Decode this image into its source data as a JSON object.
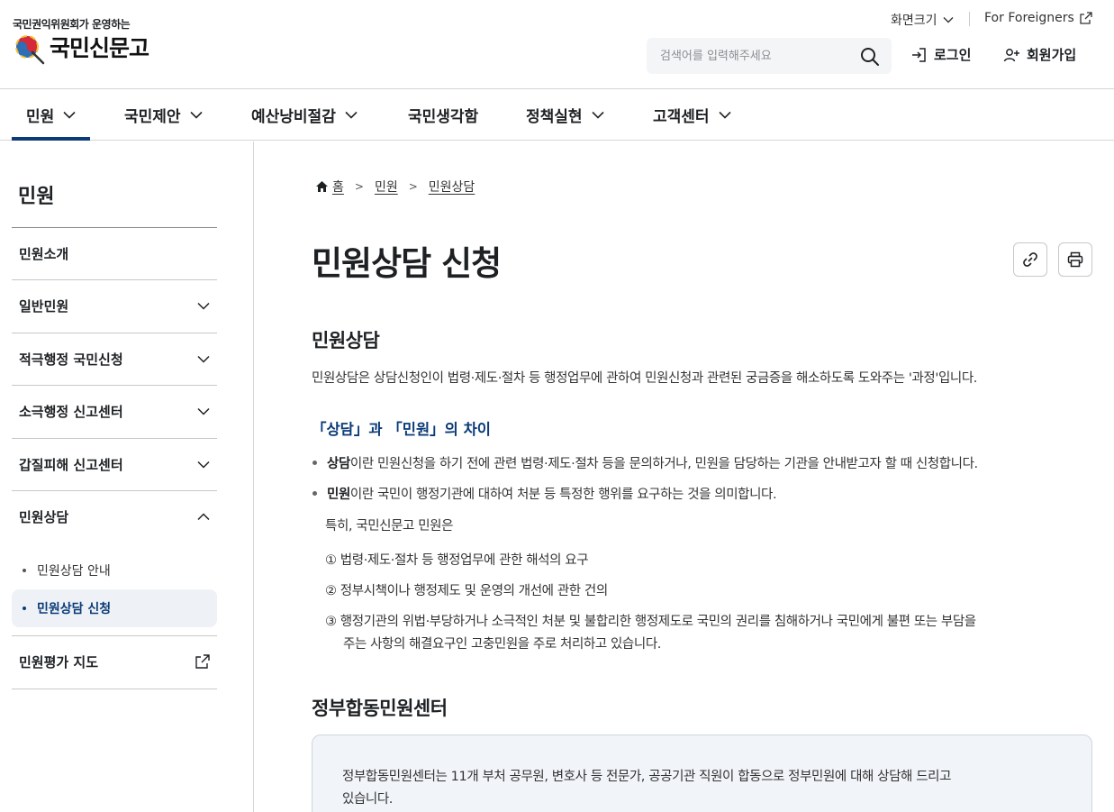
{
  "header": {
    "logo_sub": "국민권익위원회가 운영하는",
    "logo_text": "국민신문고",
    "util_size": "화면크기",
    "util_foreign": "For Foreigners",
    "search_placeholder": "검색어를 입력해주세요",
    "login": "로그인",
    "join": "회원가입"
  },
  "gnb": {
    "items": [
      {
        "label": "민원",
        "has_menu": true,
        "active": true
      },
      {
        "label": "국민제안",
        "has_menu": true
      },
      {
        "label": "예산낭비절감",
        "has_menu": true
      },
      {
        "label": "국민생각함",
        "has_menu": false
      },
      {
        "label": "정책실현",
        "has_menu": true
      },
      {
        "label": "고객센터",
        "has_menu": true
      }
    ]
  },
  "lnb": {
    "title": "민원",
    "items": [
      {
        "label": "민원소개",
        "icon": "none"
      },
      {
        "label": "일반민원",
        "icon": "chevron-down"
      },
      {
        "label": "적극행정 국민신청",
        "icon": "chevron-down"
      },
      {
        "label": "소극행정 신고센터",
        "icon": "chevron-down"
      },
      {
        "label": "갑질피해 신고센터",
        "icon": "chevron-down"
      },
      {
        "label": "민원상담",
        "icon": "chevron-up"
      },
      {
        "label": "민원평가 지도",
        "icon": "external-link"
      }
    ],
    "sub_items": [
      {
        "label": "민원상담 안내",
        "active": false
      },
      {
        "label": "민원상담 신청",
        "active": true
      }
    ]
  },
  "breadcrumb": {
    "home": "홈",
    "level1": "민원",
    "level2": "민원상담"
  },
  "content": {
    "title": "민원상담 신청",
    "section1_title": "민원상담",
    "section1_desc": "민원상담은 상담신청인이 법령·제도·절차 등 행정업무에 관하여 민원신청과 관련된 궁금증을 해소하도록 도와주는 '과정'입니다.",
    "diff_title": "「상담」과 「민원」의 차이",
    "bullet1_bold": "상담",
    "bullet1_rest": "이란 민원신청을 하기 전에 관련 법령·제도·절차 등을 문의하거나, 민원을 담당하는 기관을 안내받고자 할 때 신청합니다.",
    "bullet2_bold": "민원",
    "bullet2_rest": "이란 국민이 행정기관에 대하여 처분 등 특정한 행위를 요구하는 것을 의미합니다.",
    "special": "특히, 국민신문고 민원은",
    "num1": "① 법령·제도·절차 등 행정업무에 관한 해석의 요구",
    "num2": "② 정부시책이나 행정제도 및 운영의 개선에 관한 건의",
    "num3_line1": "③ 행정기관의 위법·부당하거나 소극적인 처분 및 불합리한 행정제도로 국민의 권리를 침해하거나 국민에게 불편 또는 부담을",
    "num3_line2": "주는 사항의 해결요구인 고충민원을 주로 처리하고 있습니다.",
    "section2_title": "정부합동민원센터",
    "box_line1": "정부합동민원센터는 11개 부처 공무원, 변호사 등 전문가, 공공기관 직원이 합동으로 정부민원에 대해 상담해 드리고",
    "box_line2": "있습니다."
  },
  "colors": {
    "accent": "#0b3b78",
    "text": "#1e2124",
    "box_bg": "#f1f4f8"
  }
}
